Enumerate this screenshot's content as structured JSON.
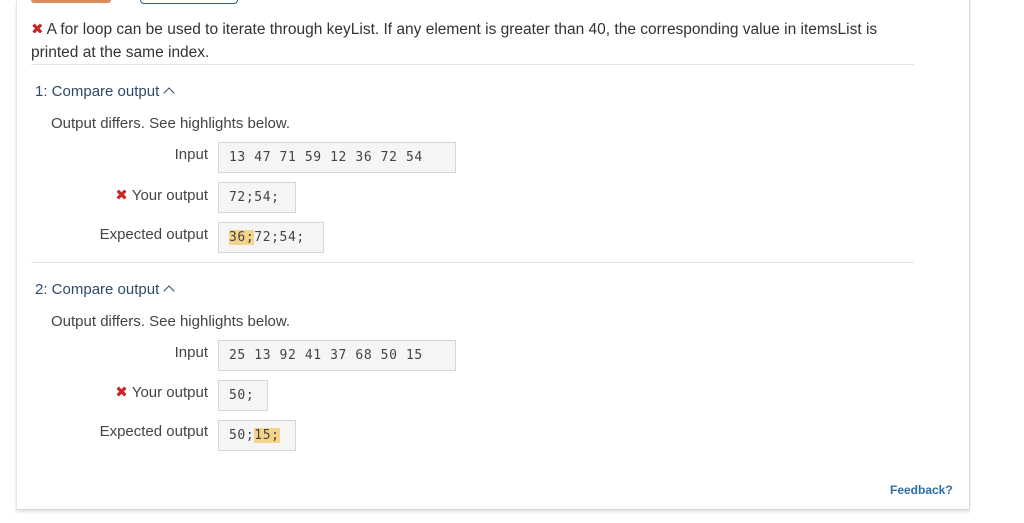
{
  "message": {
    "text": "A for loop can be used to iterate through keyList. If any element is greater than 40, the corresponding value in itemsList is printed at the same index."
  },
  "tests": [
    {
      "header": "1: Compare output",
      "status": "Output differs. See highlights below.",
      "input_label": "Input",
      "input_value": "13 47 71 59 12 36 72 54",
      "your_label": "Your output",
      "your_value": "72;54;",
      "expected_label": "Expected output",
      "expected_highlight": "36;",
      "expected_rest": "72;54;"
    },
    {
      "header": "2: Compare output",
      "status": "Output differs. See highlights below.",
      "input_label": "Input",
      "input_value": "25 13 92 41 37 68 50 15",
      "your_label": "Your output",
      "your_value": "50;",
      "expected_label": "Expected output",
      "expected_plain": "50;",
      "expected_highlight": "15;"
    }
  ],
  "feedback_label": "Feedback?",
  "colors": {
    "error": "#c62828",
    "highlight": "#f4d38a",
    "link": "#2e6da4",
    "header": "#2d4a6a"
  },
  "icons": {
    "error": "x-icon",
    "collapse": "chevron-up-icon"
  }
}
